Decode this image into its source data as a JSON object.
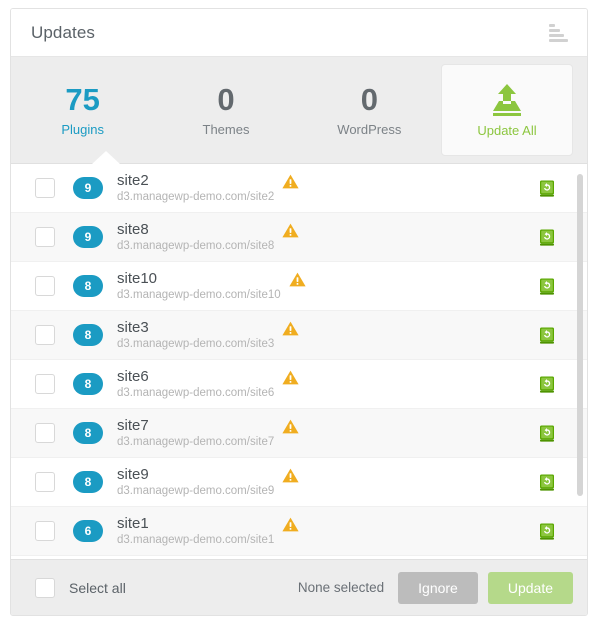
{
  "panel": {
    "title": "Updates",
    "header_icon": "bar-chart-icon"
  },
  "stats": [
    {
      "value": "75",
      "label": "Plugins",
      "active": true
    },
    {
      "value": "0",
      "label": "Themes",
      "active": false
    },
    {
      "value": "0",
      "label": "WordPress",
      "active": false
    }
  ],
  "update_all": {
    "label": "Update All",
    "icon": "upload-icon"
  },
  "list": {
    "rows": [
      {
        "count": "9",
        "name": "site2",
        "url": "d3.managewp-demo.com/site2",
        "warning": true,
        "backup": true
      },
      {
        "count": "9",
        "name": "site8",
        "url": "d3.managewp-demo.com/site8",
        "warning": true,
        "backup": true
      },
      {
        "count": "8",
        "name": "site10",
        "url": "d3.managewp-demo.com/site10",
        "warning": true,
        "backup": true
      },
      {
        "count": "8",
        "name": "site3",
        "url": "d3.managewp-demo.com/site3",
        "warning": true,
        "backup": true
      },
      {
        "count": "8",
        "name": "site6",
        "url": "d3.managewp-demo.com/site6",
        "warning": true,
        "backup": true
      },
      {
        "count": "8",
        "name": "site7",
        "url": "d3.managewp-demo.com/site7",
        "warning": true,
        "backup": true
      },
      {
        "count": "8",
        "name": "site9",
        "url": "d3.managewp-demo.com/site9",
        "warning": true,
        "backup": true
      },
      {
        "count": "6",
        "name": "site1",
        "url": "d3.managewp-demo.com/site1",
        "warning": true,
        "backup": true
      }
    ]
  },
  "footer": {
    "select_all_label": "Select all",
    "selection_status": "None selected",
    "ignore_label": "Ignore",
    "update_label": "Update"
  },
  "colors": {
    "accent_teal": "#1b9bc3",
    "accent_green": "#8cc63f",
    "warning_amber": "#f0ad20",
    "update_button": "#b5d98a",
    "ignore_button": "#bcbcbc",
    "strip_gray": "#ededed",
    "row_alt": "#f8f8f8"
  }
}
